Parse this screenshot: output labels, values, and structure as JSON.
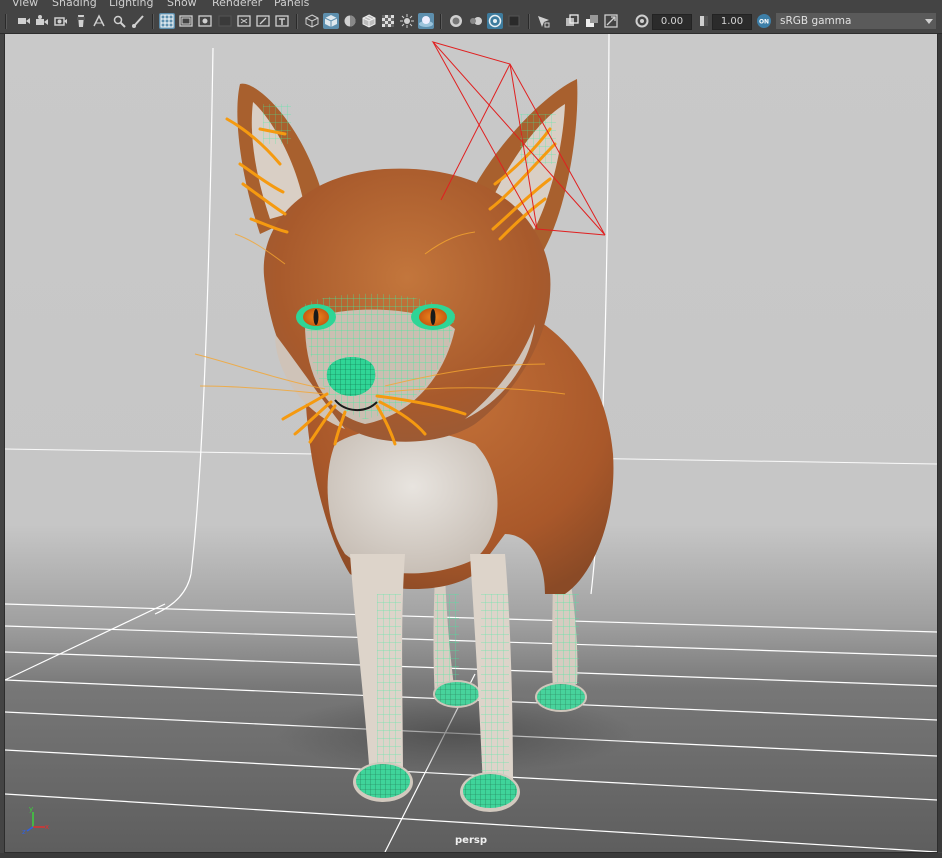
{
  "menubar": {
    "items": [
      "View",
      "Shading",
      "Lighting",
      "Show",
      "Renderer",
      "Panels"
    ]
  },
  "toolbar": {
    "icons": [
      "select-camera-icon",
      "camera-attributes-icon",
      "bookmark-icon",
      "image-plane-icon",
      "2d-pan-zoom-icon",
      "grease-pencil-icon",
      "grid-icon",
      "film-gate-icon",
      "resolution-gate-icon",
      "gate-mask-icon",
      "field-chart-icon",
      "safe-action-icon",
      "safe-title-icon",
      "wireframe-icon",
      "smooth-shade-icon",
      "default-material-icon",
      "wireframe-on-shaded-icon",
      "textured-icon",
      "use-all-lights-icon",
      "shadows-icon",
      "screen-space-ao-icon",
      "motion-blur-icon",
      "anti-aliasing-icon",
      "depth-of-field-icon",
      "isolate-select-icon",
      "xray-icon",
      "xray-joints-icon",
      "xray-active-components-icon",
      "backface-culling-icon",
      "exposure-icon",
      "gamma-icon",
      "color-management-icon"
    ],
    "exposure_value": "0.00",
    "gamma_value": "1.00",
    "color_management_badge": "ON",
    "view_transform": "sRGB gamma"
  },
  "viewport": {
    "camera_label": "persp",
    "axis_labels": {
      "x": "x",
      "y": "y",
      "z": "z"
    }
  },
  "colors": {
    "ui_bg": "#444444",
    "active_button": "#5d8fae",
    "selection_wire": "#3cf0a0",
    "hair_guides": "#f59a10",
    "camera_frustum": "#e02020",
    "fur_orange": "#b8622c",
    "fur_white": "#e3ddd6"
  }
}
